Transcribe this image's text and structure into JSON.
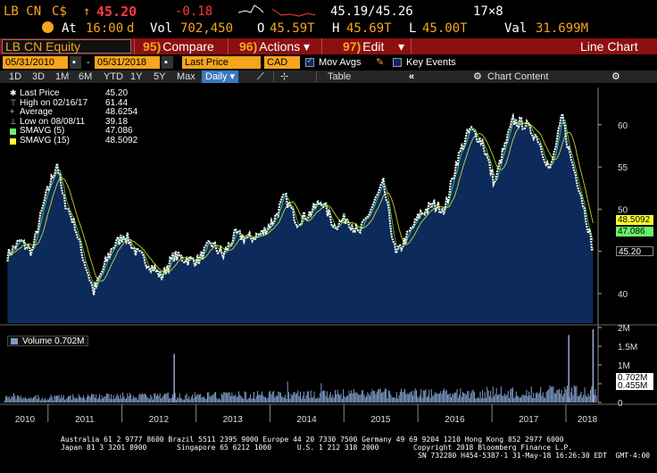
{
  "ticker": {
    "symbol": "LB CN",
    "currency_symbol": "C$",
    "arrow": "↑",
    "last": "45.20",
    "change": "-0.18",
    "bid_ask": "45.19/45.26",
    "size": "17×8",
    "at_label": "At",
    "time": "16:00",
    "time_suffix": "d",
    "vol_label": "Vol",
    "vol": "702,450",
    "open_label": "O",
    "open": "45.59T",
    "high_label": "H",
    "high": "45.69T",
    "low_label": "L",
    "low": "45.00T",
    "val_label": "Val",
    "val": "31.699M"
  },
  "function_bar": {
    "security": "LB CN Equity",
    "compare_num": "95)",
    "compare_label": "Compare",
    "actions_num": "96)",
    "actions_label": "Actions ▾",
    "edit_num": "97)",
    "edit_label": "Edit",
    "edit_arrow": "▾",
    "chart_type": "Line Chart"
  },
  "options_bar": {
    "start_date": "05/31/2010",
    "end_date": "05/31/2018",
    "field": "Last Price",
    "currency": "CAD",
    "mov_avgs": "Mov Avgs",
    "key_events": "Key Events"
  },
  "range_bar": {
    "ranges": [
      "1D",
      "3D",
      "1M",
      "6M",
      "YTD",
      "1Y",
      "5Y",
      "Max"
    ],
    "period": "Daily",
    "period_arrow": "▾",
    "table": "Table",
    "chart_content": "Chart Content",
    "collapse": "«"
  },
  "legend": {
    "last_price_label": "Last Price",
    "last_price": "45.20",
    "high_label": "High on 02/16/17",
    "high": "61.44",
    "average_label": "Average",
    "average": "48.6254",
    "low_label": "Low on 08/08/11",
    "low": "39.18",
    "smavg5_label": "SMAVG (5)",
    "smavg5": "47.086",
    "smavg15_label": "SMAVG (15)",
    "smavg15": "48.5092",
    "volume_label": "Volume",
    "volume": "0.702M"
  },
  "colors": {
    "accent_orange": "#f7a51c",
    "function_bar": "#8c1010",
    "area_fill": "#0c2a5a",
    "smavg5": "#6cf06c",
    "smavg15": "#ffff33",
    "volume": "#7e9cc9"
  },
  "chart_data": {
    "type": "area",
    "price": {
      "x": [
        "2010-06",
        "2010-08",
        "2010-10",
        "2010-12",
        "2011-02",
        "2011-03",
        "2011-05",
        "2011-06",
        "2011-08",
        "2011-09",
        "2011-11",
        "2012-01",
        "2012-03",
        "2012-05",
        "2012-07",
        "2012-09",
        "2012-11",
        "2013-01",
        "2013-03",
        "2013-05",
        "2013-07",
        "2013-09",
        "2013-11",
        "2014-01",
        "2014-03",
        "2014-05",
        "2014-07",
        "2014-09",
        "2014-11",
        "2015-01",
        "2015-03",
        "2015-05",
        "2015-07",
        "2015-09",
        "2015-11",
        "2016-01",
        "2016-03",
        "2016-05",
        "2016-07",
        "2016-09",
        "2016-11",
        "2017-01",
        "2017-02",
        "2017-04",
        "2017-06",
        "2017-08",
        "2017-10",
        "2017-12",
        "2018-01",
        "2018-03",
        "2018-04",
        "2018-05"
      ],
      "values": [
        44.5,
        46.2,
        45.0,
        51.0,
        55.5,
        51.5,
        48.0,
        45.0,
        40.2,
        42.0,
        45.5,
        47.0,
        44.8,
        43.5,
        42.0,
        44.5,
        44.0,
        44.0,
        46.0,
        44.5,
        47.0,
        46.5,
        47.0,
        48.5,
        51.5,
        48.5,
        49.5,
        51.0,
        48.0,
        49.0,
        47.0,
        50.0,
        53.0,
        44.5,
        47.0,
        49.5,
        50.5,
        50.0,
        56.0,
        59.5,
        58.0,
        53.0,
        56.0,
        60.5,
        60.0,
        58.5,
        54.5,
        61.0,
        57.0,
        52.0,
        48.5,
        45.2
      ],
      "ylim": [
        36.5,
        64.0
      ],
      "yticks": [
        40,
        45,
        50,
        55,
        60
      ]
    },
    "volume": {
      "ylim": [
        0,
        2.0
      ],
      "yticks": [
        "0",
        "0.5M",
        "1M",
        "1.5M",
        "2M"
      ],
      "spikes": [
        {
          "x": "2012-09",
          "value": 1.3
        },
        {
          "x": "2018-01",
          "value": 1.8
        },
        {
          "x": "2018-05",
          "value": 1.95
        }
      ]
    },
    "x_labels": [
      "2010",
      "2011",
      "2012",
      "2013",
      "2014",
      "2015",
      "2016",
      "2017",
      "2018"
    ],
    "tags": {
      "smavg15": "48.5092",
      "smavg5": "47.086",
      "last": "45.20",
      "volume_a": "0.702M",
      "volume_b": "0.455M"
    }
  },
  "footer": {
    "line1": "Australia 61 2 9777 8600 Brazil 5511 2395 9000 Europe 44 20 7330 7500 Germany 49 69 9204 1210 Hong Kong 852 2977 6000",
    "line2": "Japan 81 3 3201 8900       Singapore 65 6212 1000      U.S. 1 212 318 2000        Copyright 2018 Bloomberg Finance L.P.",
    "line3": "SN 732280 H454-5387-1 31-May-18 16:26:30 EDT  GMT-4:00"
  }
}
